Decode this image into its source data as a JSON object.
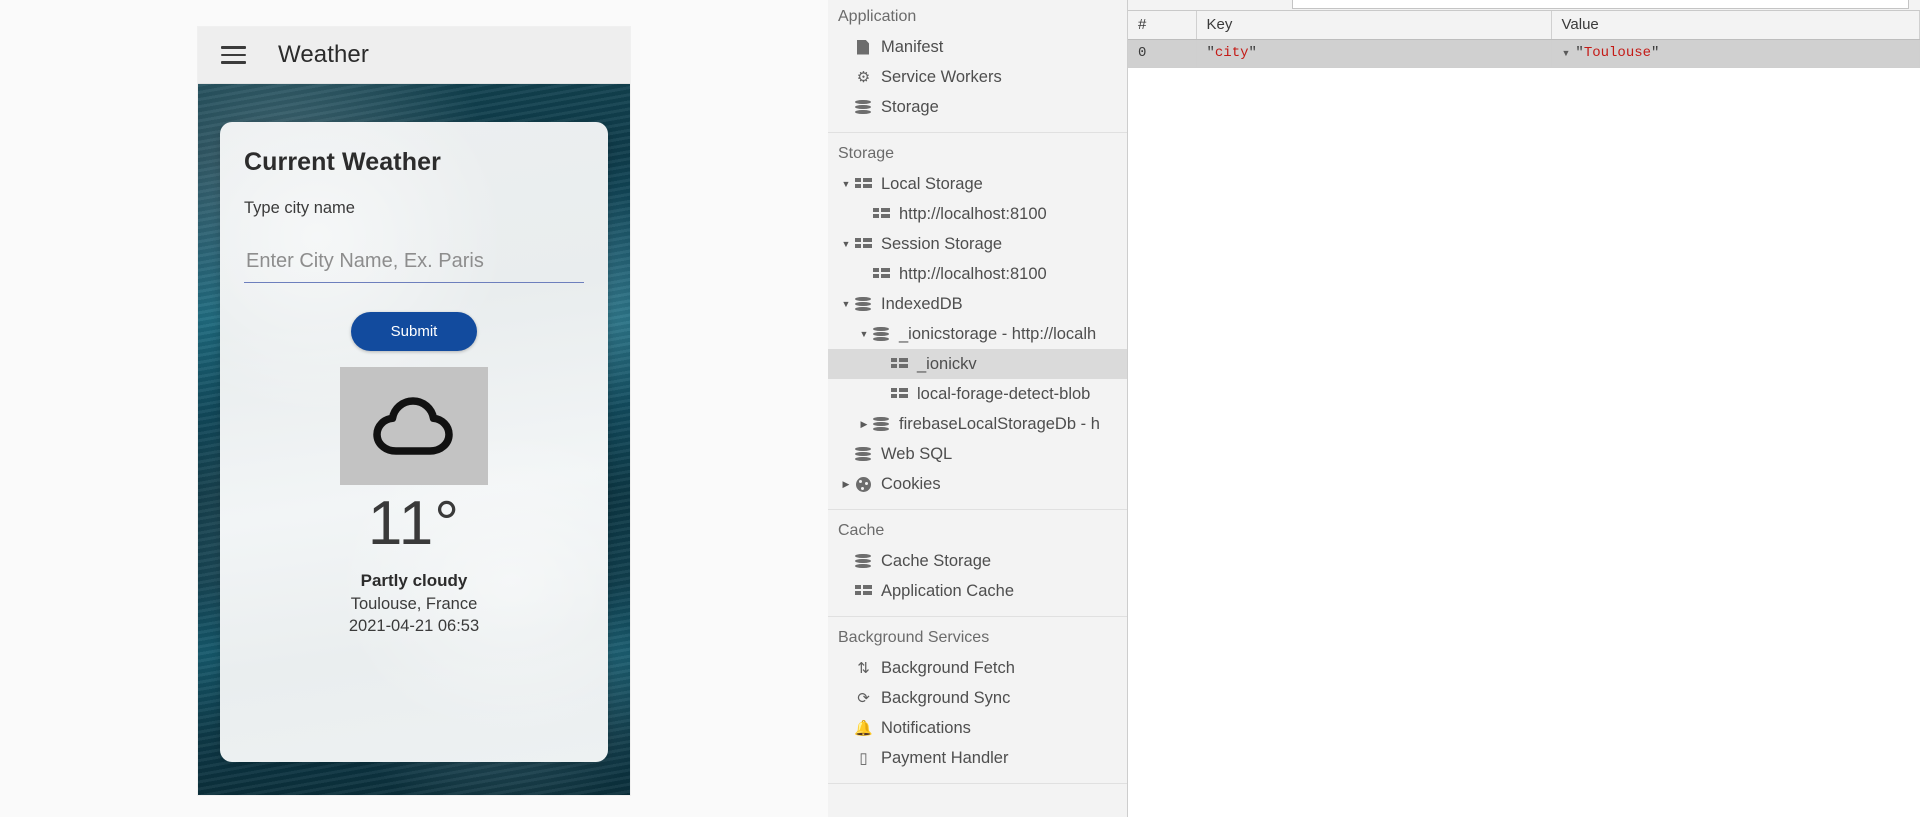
{
  "phone": {
    "toolbar": {
      "title": "Weather",
      "menu_icon": "hamburger-menu-icon"
    },
    "card": {
      "title": "Current Weather",
      "subtitle": "Type city name",
      "input_value": "",
      "input_placeholder": "Enter City Name, Ex. Paris",
      "submit_label": "Submit",
      "weather_icon": "cloud-icon",
      "temperature": "11°",
      "condition": "Partly cloudy",
      "location": "Toulouse, France",
      "timestamp": "2021-04-21 06:53"
    },
    "colors": {
      "submit_bg": "#124b9e",
      "input_underline": "#6d7fbd",
      "toolbar_bg": "#eeeeee"
    }
  },
  "devtools": {
    "sidebar": {
      "groups": [
        {
          "title": "Application",
          "items": [
            {
              "label": "Manifest",
              "icon": "document-icon",
              "indent": 0,
              "twisty": "",
              "selected": false
            },
            {
              "label": "Service Workers",
              "icon": "gear-icon",
              "indent": 0,
              "twisty": "",
              "selected": false
            },
            {
              "label": "Storage",
              "icon": "database-icon",
              "indent": 0,
              "twisty": "",
              "selected": false
            }
          ]
        },
        {
          "title": "Storage",
          "items": [
            {
              "label": "Local Storage",
              "icon": "table-icon",
              "indent": 0,
              "twisty": "▼",
              "selected": false
            },
            {
              "label": "http://localhost:8100",
              "icon": "table-icon",
              "indent": 1,
              "twisty": "",
              "selected": false
            },
            {
              "label": "Session Storage",
              "icon": "table-icon",
              "indent": 0,
              "twisty": "▼",
              "selected": false
            },
            {
              "label": "http://localhost:8100",
              "icon": "table-icon",
              "indent": 1,
              "twisty": "",
              "selected": false
            },
            {
              "label": "IndexedDB",
              "icon": "database-icon",
              "indent": 0,
              "twisty": "▼",
              "selected": false
            },
            {
              "label": "_ionicstorage - http://localh",
              "icon": "database-icon",
              "indent": 1,
              "twisty": "▼",
              "selected": false
            },
            {
              "label": "_ionickv",
              "icon": "table-icon",
              "indent": 2,
              "twisty": "",
              "selected": true
            },
            {
              "label": "local-forage-detect-blob",
              "icon": "table-icon",
              "indent": 2,
              "twisty": "",
              "selected": false
            },
            {
              "label": "firebaseLocalStorageDb - h",
              "icon": "database-icon",
              "indent": 1,
              "twisty": "▶",
              "selected": false
            },
            {
              "label": "Web SQL",
              "icon": "database-icon",
              "indent": 0,
              "twisty": "",
              "selected": false
            },
            {
              "label": "Cookies",
              "icon": "cookie-icon",
              "indent": 0,
              "twisty": "▶",
              "selected": false
            }
          ]
        },
        {
          "title": "Cache",
          "items": [
            {
              "label": "Cache Storage",
              "icon": "database-icon",
              "indent": 0,
              "twisty": "",
              "selected": false
            },
            {
              "label": "Application Cache",
              "icon": "table-icon",
              "indent": 0,
              "twisty": "",
              "selected": false
            }
          ]
        },
        {
          "title": "Background Services",
          "items": [
            {
              "label": "Background Fetch",
              "icon": "up-down-arrows-icon",
              "indent": 0,
              "twisty": "",
              "selected": false
            },
            {
              "label": "Background Sync",
              "icon": "refresh-icon",
              "indent": 0,
              "twisty": "",
              "selected": false
            },
            {
              "label": "Notifications",
              "icon": "bell-icon",
              "indent": 0,
              "twisty": "",
              "selected": false
            },
            {
              "label": "Payment Handler",
              "icon": "credit-card-icon",
              "indent": 0,
              "twisty": "",
              "selected": false
            }
          ]
        }
      ]
    },
    "table": {
      "columns": [
        "#",
        "Key",
        "Value"
      ],
      "rows": [
        {
          "index": "0",
          "key_quote_open": "\"",
          "key": "city",
          "key_quote_close": "\"",
          "value_expander": "▼",
          "value_quote_open": "\"",
          "value": "Toulouse",
          "value_quote_close": "\"",
          "selected": true
        }
      ]
    }
  }
}
